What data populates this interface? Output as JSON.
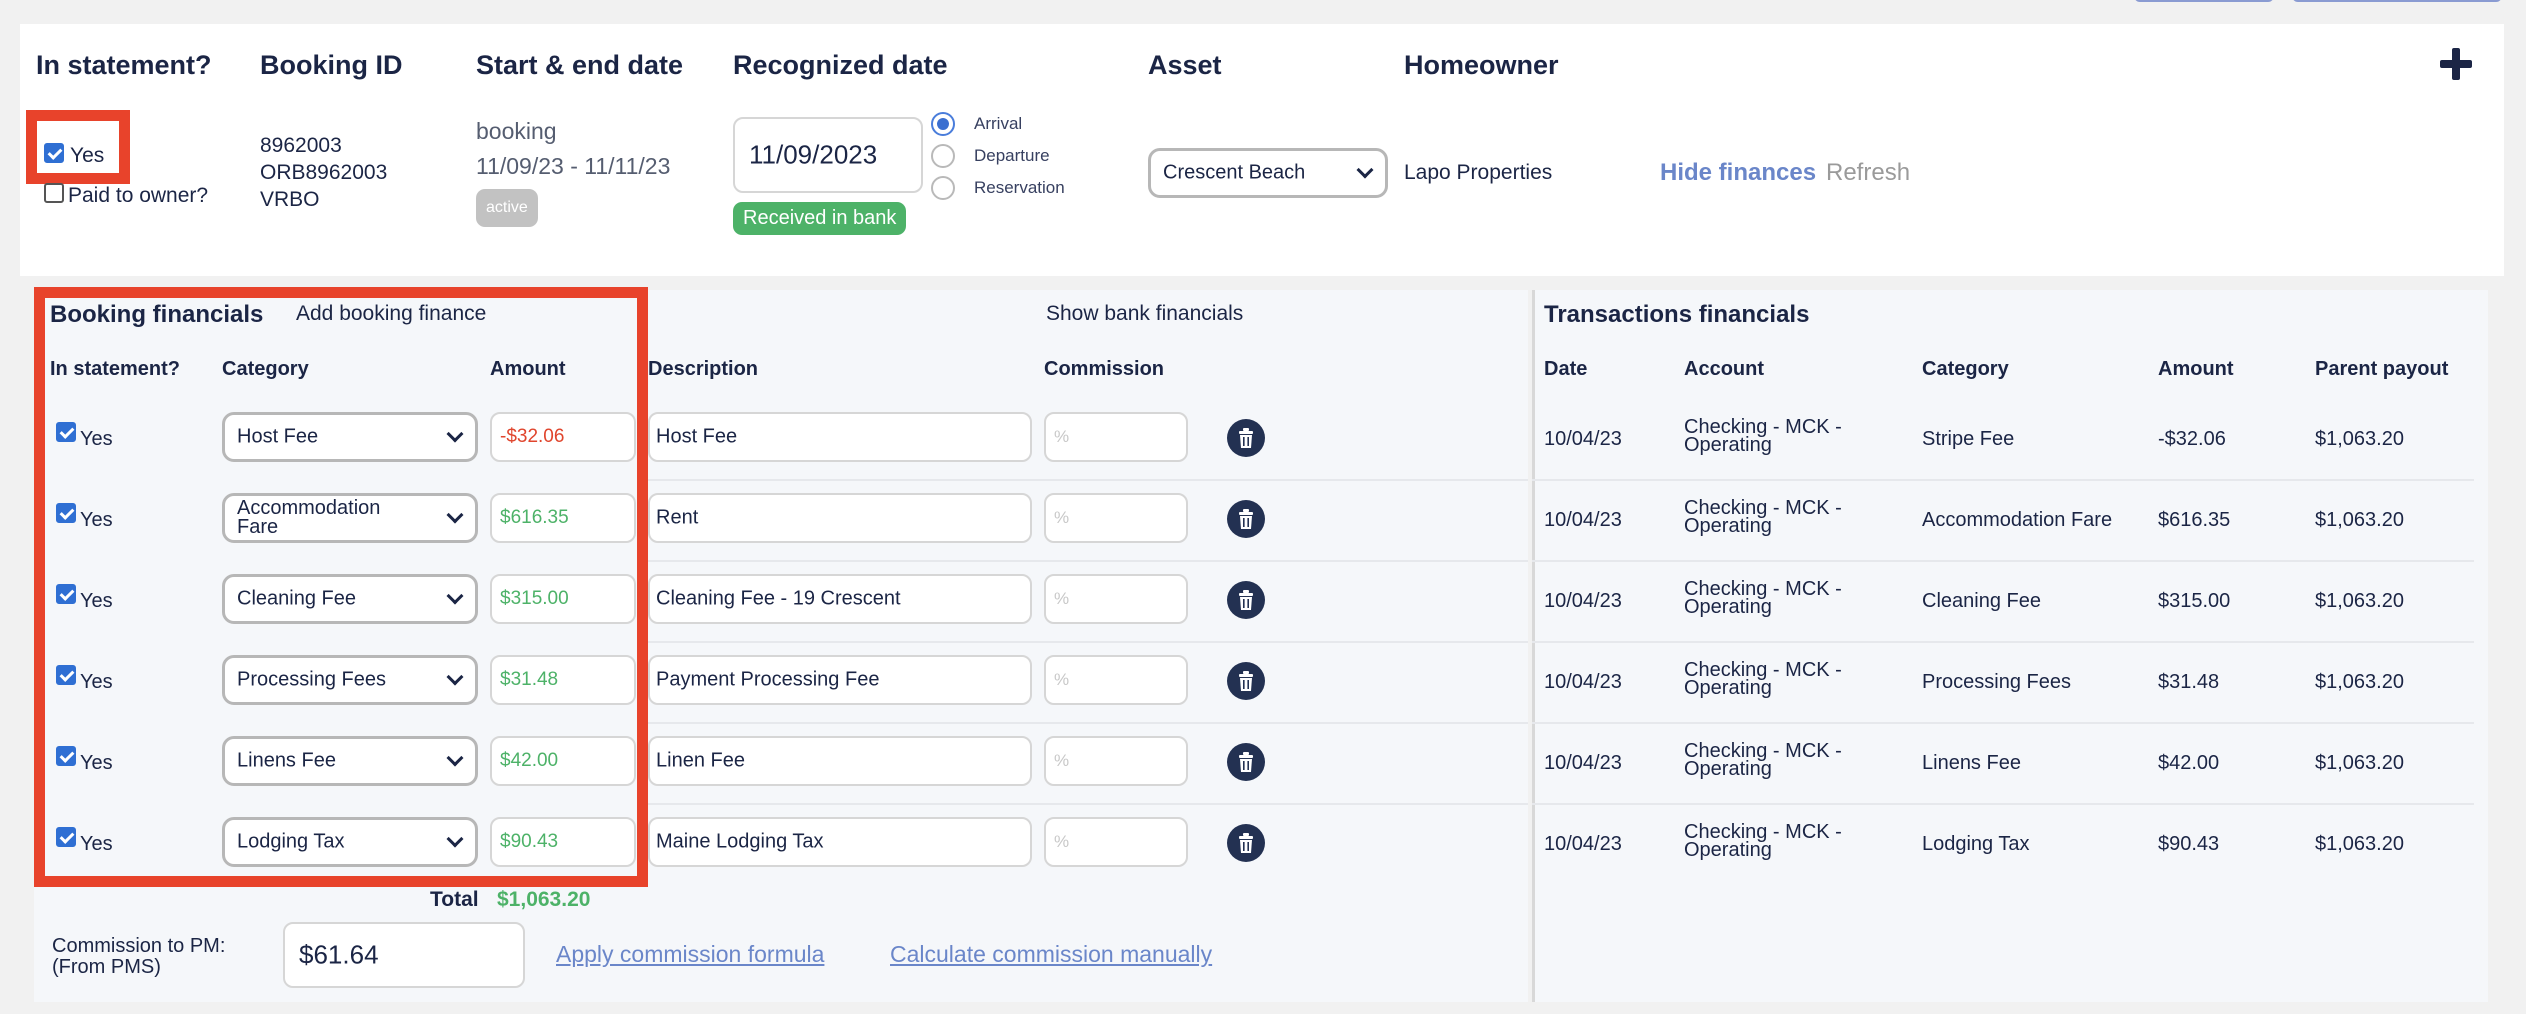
{
  "header": {
    "col_in_statement": "In statement?",
    "col_booking_id": "Booking ID",
    "col_dates": "Start & end date",
    "col_recognized": "Recognized date",
    "col_asset": "Asset",
    "col_homeowner": "Homeowner",
    "add_icon": "plus-icon"
  },
  "booking": {
    "in_statement_label": "Yes",
    "paid_to_owner_label": "Paid to owner?",
    "id_line1": "8962003",
    "id_line2": "ORB8962003",
    "id_line3": "VRBO",
    "date_type": "booking",
    "date_range": "11/09/23 - 11/11/23",
    "status_badge": "active",
    "recognized_date": "11/09/2023",
    "received_badge": "Received in bank",
    "radio_arrival": "Arrival",
    "radio_departure": "Departure",
    "radio_reservation": "Reservation",
    "selected_radio": "Arrival",
    "asset": "Crescent Beach",
    "homeowner": "Lapo Properties",
    "hide_finances": "Hide finances",
    "refresh": "Refresh"
  },
  "booking_financials": {
    "title": "Booking financials",
    "add_label": "Add booking finance",
    "show_bank": "Show bank financials",
    "col_in_statement": "In statement?",
    "col_category": "Category",
    "col_amount": "Amount",
    "col_description": "Description",
    "col_commission": "Commission",
    "commission_placeholder": "%",
    "rows": [
      {
        "yes": "Yes",
        "category": "Host Fee",
        "amount": "-$32.06",
        "description": "Host Fee"
      },
      {
        "yes": "Yes",
        "category": "Accommodation Fare",
        "amount": "$616.35",
        "description": "Rent"
      },
      {
        "yes": "Yes",
        "category": "Cleaning Fee",
        "amount": "$315.00",
        "description": "Cleaning Fee - 19 Crescent"
      },
      {
        "yes": "Yes",
        "category": "Processing Fees",
        "amount": "$31.48",
        "description": "Payment Processing Fee"
      },
      {
        "yes": "Yes",
        "category": "Linens Fee",
        "amount": "$42.00",
        "description": "Linen Fee"
      },
      {
        "yes": "Yes",
        "category": "Lodging Tax",
        "amount": "$90.43",
        "description": "Maine Lodging Tax"
      }
    ],
    "total_label": "Total",
    "total_value": "$1,063.20",
    "commission_label_1": "Commission to PM:",
    "commission_label_2": "(From PMS)",
    "commission_value": "$61.64",
    "apply_formula": "Apply commission formula",
    "calc_manual": "Calculate commission manually"
  },
  "transactions": {
    "title": "Transactions financials",
    "col_date": "Date",
    "col_account": "Account",
    "col_category": "Category",
    "col_amount": "Amount",
    "col_parent": "Parent payout",
    "rows": [
      {
        "date": "10/04/23",
        "account1": "Checking - MCK -",
        "account2": "Operating",
        "category": "Stripe Fee",
        "amount": "-$32.06",
        "parent": "$1,063.20"
      },
      {
        "date": "10/04/23",
        "account1": "Checking - MCK -",
        "account2": "Operating",
        "category": "Accommodation Fare",
        "amount": "$616.35",
        "parent": "$1,063.20"
      },
      {
        "date": "10/04/23",
        "account1": "Checking - MCK -",
        "account2": "Operating",
        "category": "Cleaning Fee",
        "amount": "$315.00",
        "parent": "$1,063.20"
      },
      {
        "date": "10/04/23",
        "account1": "Checking - MCK -",
        "account2": "Operating",
        "category": "Processing Fees",
        "amount": "$31.48",
        "parent": "$1,063.20"
      },
      {
        "date": "10/04/23",
        "account1": "Checking - MCK -",
        "account2": "Operating",
        "category": "Linens Fee",
        "amount": "$42.00",
        "parent": "$1,063.20"
      },
      {
        "date": "10/04/23",
        "account1": "Checking - MCK -",
        "account2": "Operating",
        "category": "Lodging Tax",
        "amount": "$90.43",
        "parent": "$1,063.20"
      }
    ]
  },
  "colors": {
    "highlight": "#e8432b",
    "negative": "#e0452d",
    "positive": "#4db268",
    "link": "#6a86c9",
    "navy": "#1b2545"
  }
}
